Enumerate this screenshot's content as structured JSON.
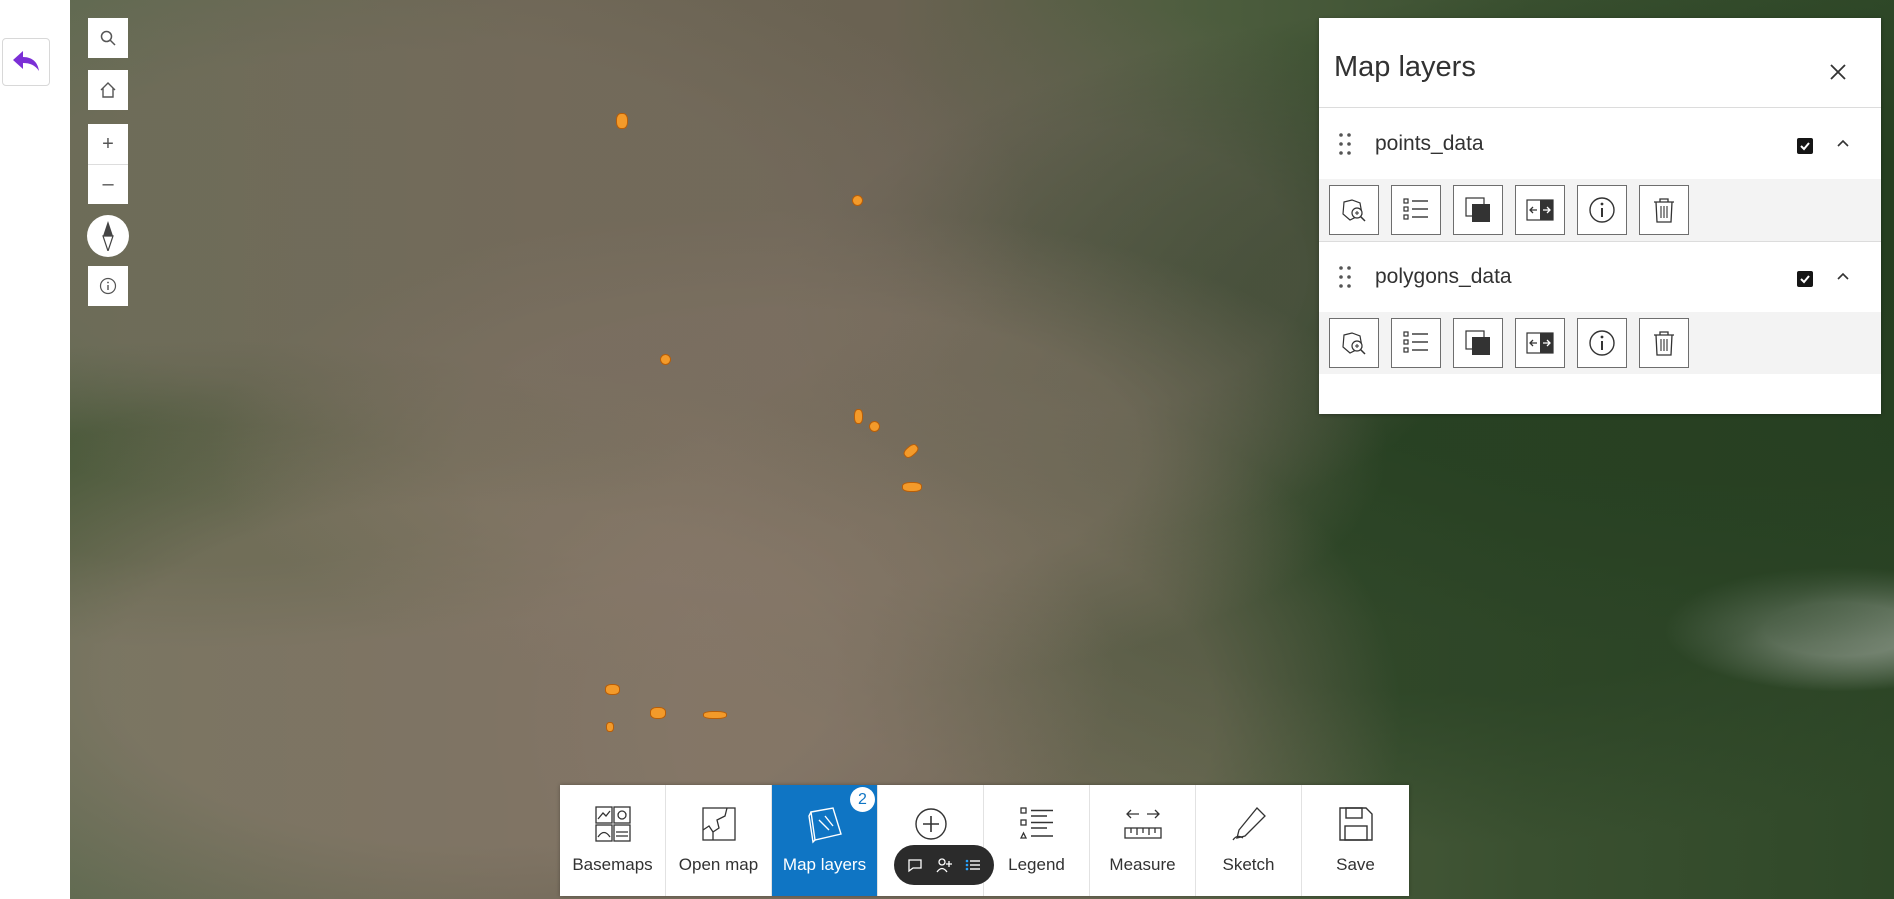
{
  "colors": {
    "accent": "#0f75c4",
    "back_arrow": "#7b2fd6",
    "feature_fill": "#f39a2a"
  },
  "map_controls": {
    "search_icon": "search-icon",
    "home_icon": "home-icon",
    "zoom_in": "+",
    "zoom_out": "–",
    "compass_icon": "compass-icon",
    "info": "i"
  },
  "panel": {
    "title": "Map layers",
    "layers": [
      {
        "name": "points_data",
        "visible": true,
        "expanded": true
      },
      {
        "name": "polygons_data",
        "visible": true,
        "expanded": true
      }
    ],
    "layer_tools": [
      "zoom-to-icon",
      "attribute-table-icon",
      "overlay-icon",
      "swipe-icon",
      "info-icon",
      "delete-icon"
    ]
  },
  "toolbar": {
    "items": [
      {
        "label": "Basemaps",
        "icon": "basemaps-icon",
        "active": false
      },
      {
        "label": "Open map",
        "icon": "open-map-icon",
        "active": false
      },
      {
        "label": "Map layers",
        "icon": "map-layers-icon",
        "active": true,
        "badge": "2"
      },
      {
        "label": "",
        "icon": "add-circle-icon",
        "active": false
      },
      {
        "label": "Legend",
        "icon": "legend-icon",
        "active": false
      },
      {
        "label": "Measure",
        "icon": "measure-icon",
        "active": false
      },
      {
        "label": "Sketch",
        "icon": "sketch-icon",
        "active": false
      },
      {
        "label": "Save",
        "icon": "save-icon",
        "active": false
      }
    ]
  }
}
